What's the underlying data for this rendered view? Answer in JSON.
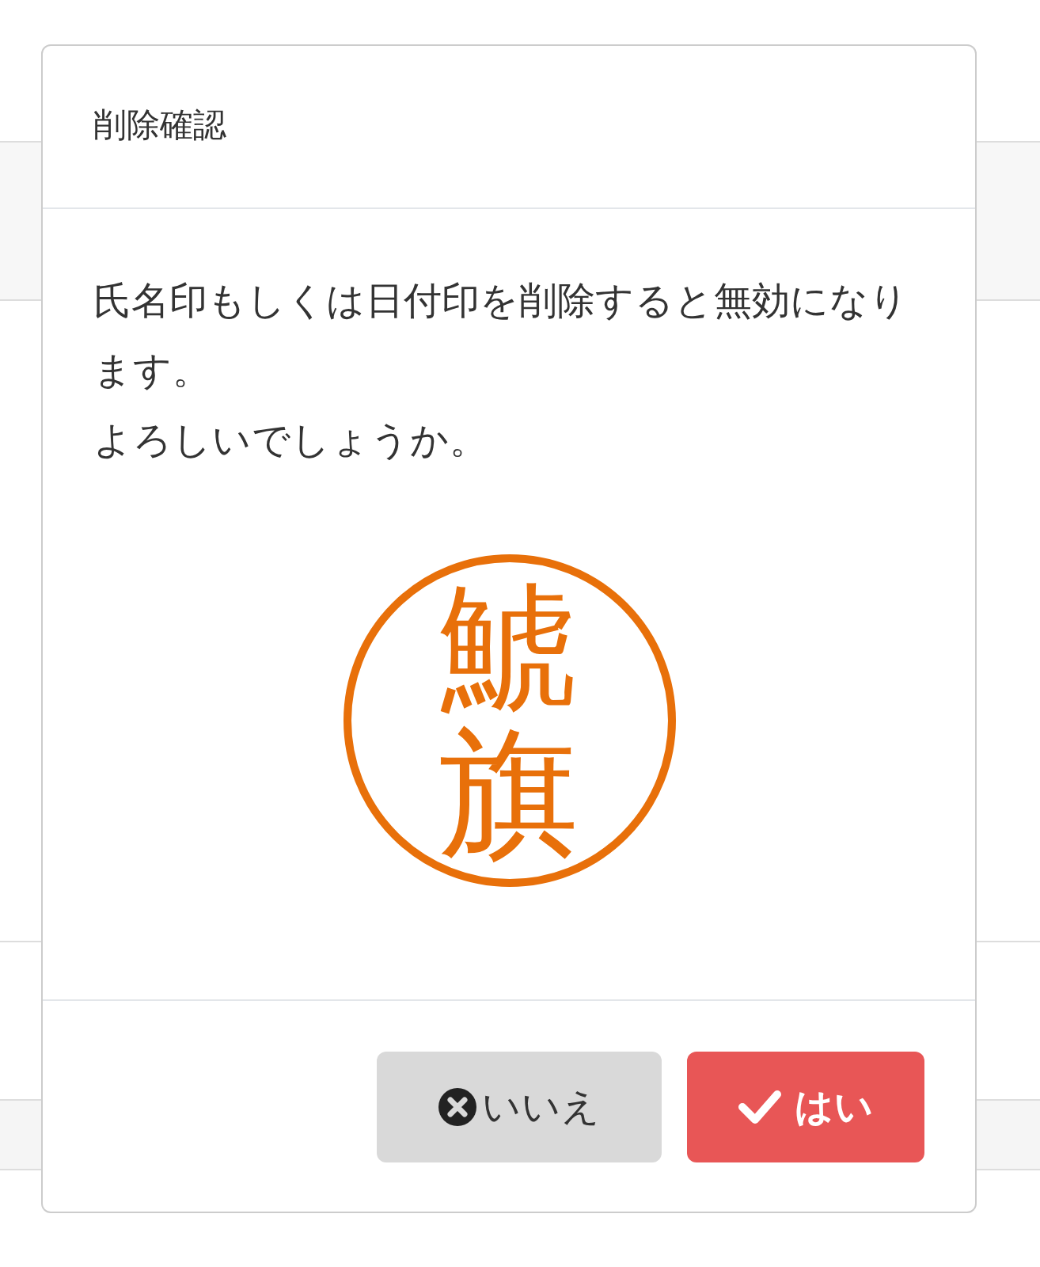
{
  "dialog": {
    "title": "削除確認",
    "message_lines": [
      "氏名印もしくは日付印を削除すると無効になります。",
      "よろしいでしょうか。"
    ],
    "seal": {
      "text": "鯱旗"
    },
    "buttons": [
      {
        "kind": "cancel",
        "label": "いいえ"
      },
      {
        "kind": "confirm",
        "label": "はい"
      }
    ]
  }
}
